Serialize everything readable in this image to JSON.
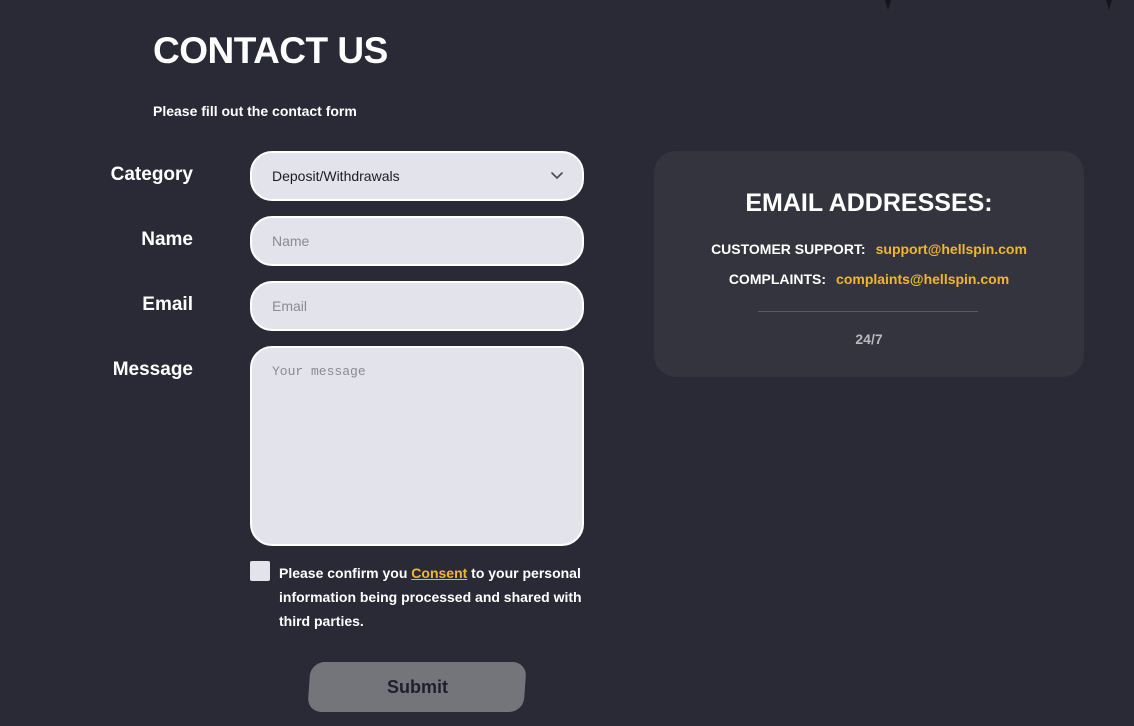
{
  "header": {
    "title": "CONTACT US",
    "subtitle": "Please fill out the contact form"
  },
  "form": {
    "category": {
      "label": "Category",
      "selected": "Deposit/Withdrawals"
    },
    "name": {
      "label": "Name",
      "placeholder": "Name",
      "value": ""
    },
    "email": {
      "label": "Email",
      "placeholder": "Email",
      "value": ""
    },
    "message": {
      "label": "Message",
      "placeholder": "Your message",
      "value": ""
    },
    "consent": {
      "checked": false,
      "text_before": "Please confirm you ",
      "link_text": "Consent",
      "text_after": " to your personal information being processed and shared with third parties."
    },
    "submit_label": "Submit"
  },
  "contact_panel": {
    "title": "EMAIL ADDRESSES:",
    "rows": [
      {
        "label": "CUSTOMER SUPPORT:",
        "email": "support@hellspin.com"
      },
      {
        "label": "COMPLAINTS:",
        "email": "complaints@hellspin.com"
      }
    ],
    "hours": "24/7"
  },
  "icons": {
    "select_arrow": "chevron-down-icon",
    "consent_box": "checkbox-icon"
  },
  "colors": {
    "background": "#2a2a37",
    "panel": "#34343f",
    "accent": "#f3b62a",
    "input_bg": "#e3e3ec",
    "button": "#74747b"
  }
}
